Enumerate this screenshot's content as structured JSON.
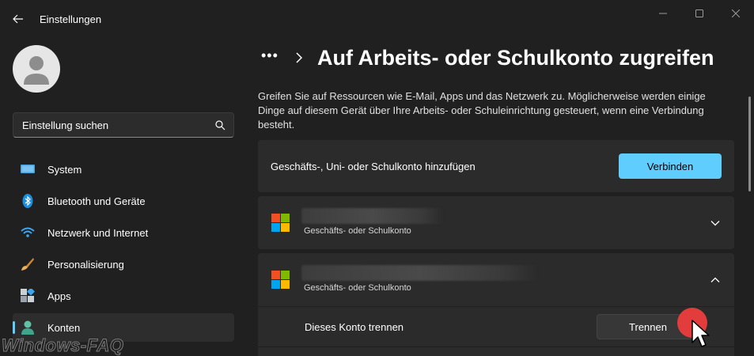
{
  "window": {
    "title": "Einstellungen"
  },
  "sidebar": {
    "search_placeholder": "Einstellung suchen",
    "items": [
      {
        "label": "System",
        "icon": "monitor-icon"
      },
      {
        "label": "Bluetooth und Geräte",
        "icon": "bluetooth-icon"
      },
      {
        "label": "Netzwerk und Internet",
        "icon": "wifi-icon"
      },
      {
        "label": "Personalisierung",
        "icon": "brush-icon"
      },
      {
        "label": "Apps",
        "icon": "apps-icon"
      },
      {
        "label": "Konten",
        "icon": "person-icon",
        "selected": true
      }
    ]
  },
  "main": {
    "breadcrumb_dots": "•••",
    "title": "Auf Arbeits- oder Schulkonto zugreifen",
    "description": "Greifen Sie auf Ressourcen wie E-Mail, Apps und das Netzwerk zu. Möglicherweise werden einige Dinge auf diesem Gerät über Ihre Arbeits- oder Schuleinrichtung gesteuert, wenn eine Verbindung besteht.",
    "add_account": {
      "label": "Geschäfts-, Uni- oder Schulkonto hinzufügen",
      "button": "Verbinden"
    },
    "accounts": [
      {
        "type": "Geschäfts- oder Schulkonto",
        "expanded": false
      },
      {
        "type": "Geschäfts- oder Schulkonto",
        "expanded": true
      }
    ],
    "disconnect": {
      "label": "Dieses Konto trennen",
      "button": "Trennen"
    }
  },
  "watermark": "Windows-FAQ",
  "colors": {
    "accent": "#60cdff",
    "background": "#202020",
    "card": "#2b2b2b",
    "click_indicator": "#e23c3c"
  }
}
